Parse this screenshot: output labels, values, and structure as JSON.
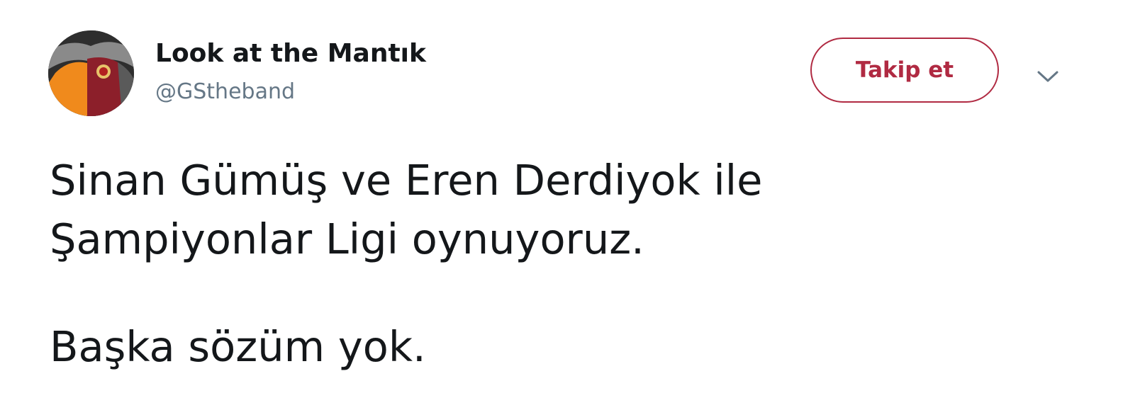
{
  "user": {
    "display_name": "Look at the Mantık",
    "handle": "@GStheband",
    "avatar_icon": "avatar-image"
  },
  "actions": {
    "follow_label": "Takip et",
    "menu_icon": "chevron-down-icon"
  },
  "tweet": {
    "lines": [
      "Sinan Gümüş ve Eren Derdiyok ile",
      "Şampiyonlar Ligi oynuyoruz.",
      "Başka sözüm yok."
    ]
  },
  "colors": {
    "follow_accent": "#b02a42",
    "name_text": "#14171a",
    "handle_text": "#657786"
  }
}
